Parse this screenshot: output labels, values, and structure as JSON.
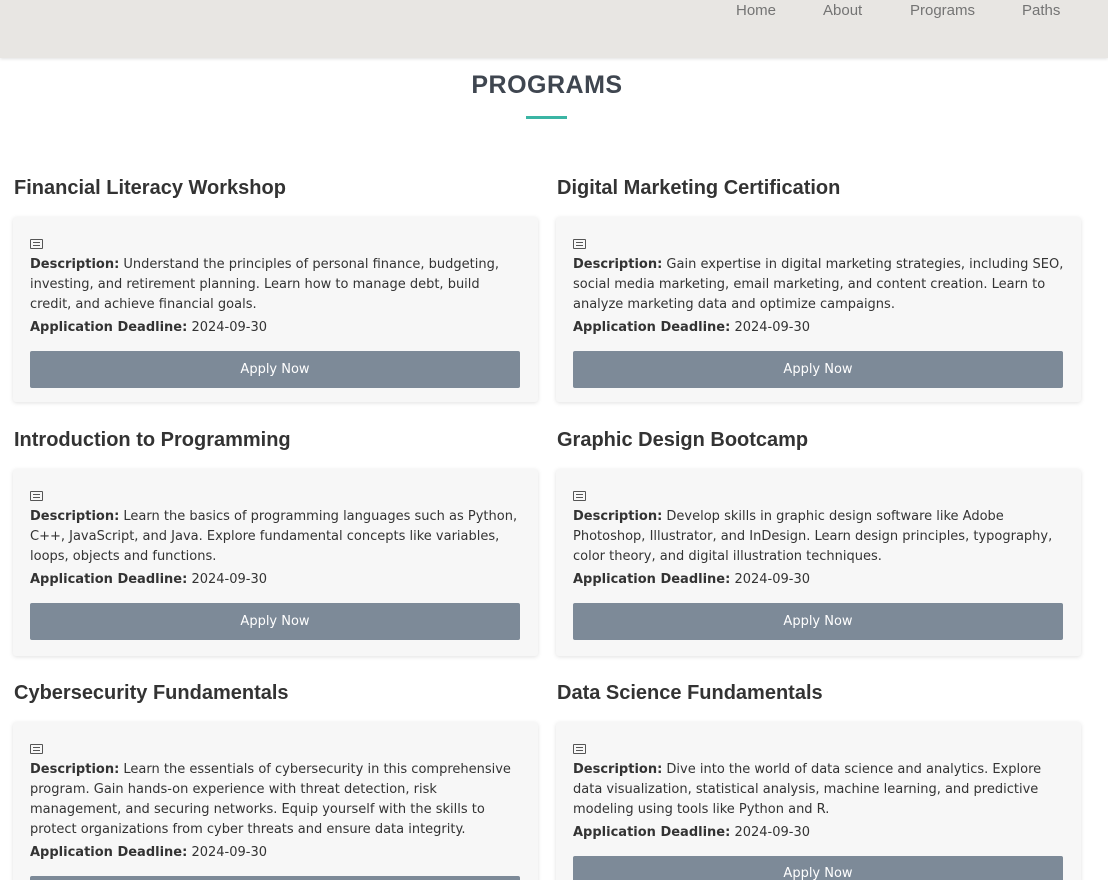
{
  "nav": {
    "items": [
      {
        "label": "Home"
      },
      {
        "label": "About"
      },
      {
        "label": "Programs"
      },
      {
        "label": "Paths"
      }
    ]
  },
  "page": {
    "title": "PROGRAMS"
  },
  "labels": {
    "description": "Description:",
    "deadline": "Application Deadline:",
    "apply": "Apply Now"
  },
  "programs": [
    {
      "name": "Financial Literacy Workshop",
      "description": "Understand the principles of personal finance, budgeting, investing, and retirement planning. Learn how to manage debt, build credit, and achieve financial goals.",
      "deadline": "2024-09-30"
    },
    {
      "name": "Digital Marketing Certification",
      "description": "Gain expertise in digital marketing strategies, including SEO, social media marketing, email marketing, and content creation. Learn to analyze marketing data and optimize campaigns.",
      "deadline": "2024-09-30"
    },
    {
      "name": "Introduction to Programming",
      "description": "Learn the basics of programming languages such as Python, C++, JavaScript, and Java. Explore fundamental concepts like variables, loops, objects and functions.",
      "deadline": "2024-09-30"
    },
    {
      "name": "Graphic Design Bootcamp",
      "description": "Develop skills in graphic design software like Adobe Photoshop, Illustrator, and InDesign. Learn design principles, typography, color theory, and digital illustration techniques.",
      "deadline": "2024-09-30"
    },
    {
      "name": "Cybersecurity Fundamentals",
      "description": "Learn the essentials of cybersecurity in this comprehensive program. Gain hands-on experience with threat detection, risk management, and securing networks. Equip yourself with the skills to protect organizations from cyber threats and ensure data integrity.",
      "deadline": "2024-09-30"
    },
    {
      "name": "Data Science Fundamentals",
      "description": "Dive into the world of data science and analytics. Explore data visualization, statistical analysis, machine learning, and predictive modeling using tools like Python and R.",
      "deadline": "2024-09-30"
    }
  ]
}
